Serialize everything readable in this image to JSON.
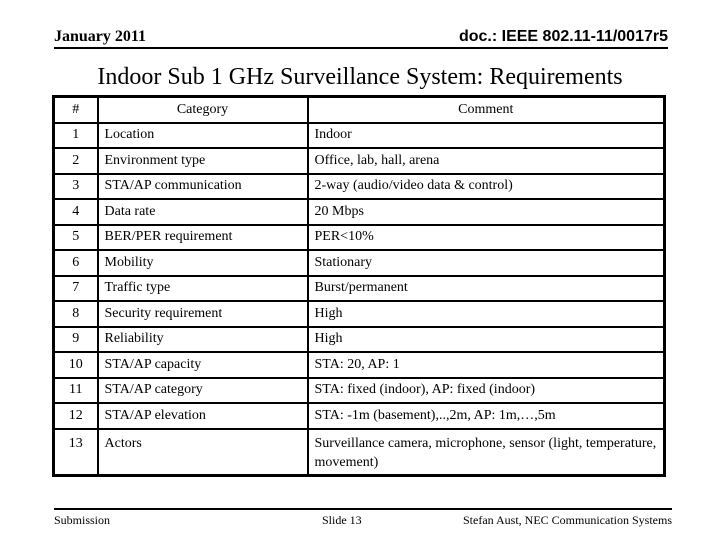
{
  "header": {
    "date": "January 2011",
    "doc_id": "doc.: IEEE 802.11-11/0017r5"
  },
  "title": "Indoor Sub 1 GHz Surveillance System: Requirements",
  "table": {
    "columns": [
      "#",
      "Category",
      "Comment"
    ],
    "rows": [
      {
        "num": "1",
        "category": "Location",
        "comment": "Indoor"
      },
      {
        "num": "2",
        "category": "Environment type",
        "comment": "Office, lab, hall, arena"
      },
      {
        "num": "3",
        "category": "STA/AP communication",
        "comment": "2-way (audio/video data & control)"
      },
      {
        "num": "4",
        "category": "Data rate",
        "comment": "20 Mbps"
      },
      {
        "num": "5",
        "category": "BER/PER requirement",
        "comment": "PER<10%"
      },
      {
        "num": "6",
        "category": "Mobility",
        "comment": "Stationary"
      },
      {
        "num": "7",
        "category": "Traffic type",
        "comment": "Burst/permanent"
      },
      {
        "num": "8",
        "category": "Security requirement",
        "comment": "High"
      },
      {
        "num": "9",
        "category": "Reliability",
        "comment": "High"
      },
      {
        "num": "10",
        "category": "STA/AP capacity",
        "comment": "STA: 20, AP: 1"
      },
      {
        "num": "11",
        "category": "STA/AP category",
        "comment": "STA: fixed (indoor), AP: fixed (indoor)"
      },
      {
        "num": "12",
        "category": "STA/AP elevation",
        "comment": "STA: -1m (basement),..,2m, AP: 1m,…,5m"
      },
      {
        "num": "13",
        "category": "Actors",
        "comment": "Surveillance camera, microphone, sensor (light, temperature, movement)"
      }
    ]
  },
  "footer": {
    "left": "Submission",
    "center": "Slide 13",
    "right": "Stefan Aust, NEC Communication Systems"
  }
}
